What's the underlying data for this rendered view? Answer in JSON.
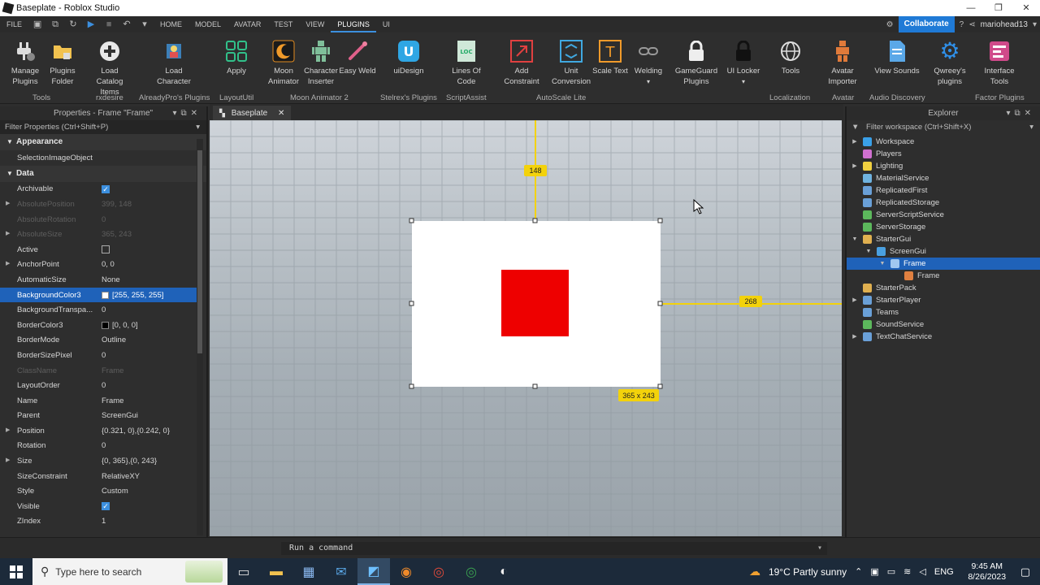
{
  "window": {
    "title": "Baseplate - Roblox Studio"
  },
  "menu": {
    "tabs": [
      "FILE",
      "HOME",
      "MODEL",
      "AVATAR",
      "TEST",
      "VIEW",
      "PLUGINS",
      "UI"
    ],
    "active_tab": "PLUGINS",
    "collaborate": "Collaborate",
    "user": "mariohead13"
  },
  "ribbon": {
    "buttons": [
      {
        "label": "Manage Plugins",
        "icon": "plug-icon"
      },
      {
        "label": "Plugins Folder",
        "icon": "folder-icon"
      },
      {
        "label": "Load Catalog Items",
        "icon": "plus-circle-icon"
      },
      {
        "label": "Load Character",
        "icon": "character-icon"
      },
      {
        "label": "Apply",
        "icon": "grid-icon"
      },
      {
        "label": "Moon Animator",
        "icon": "moon-icon"
      },
      {
        "label": "Character Inserter",
        "icon": "figure-icon"
      },
      {
        "label": "Easy Weld",
        "icon": "weld-icon"
      },
      {
        "label": "uiDesign",
        "icon": "ui-design-icon"
      },
      {
        "label": "Lines Of Code",
        "icon": "loc-icon"
      },
      {
        "label": "Add Constraint",
        "icon": "constraint-icon"
      },
      {
        "label": "Unit Conversion",
        "icon": "unit-icon"
      },
      {
        "label": "Scale Text",
        "icon": "text-scale-icon"
      },
      {
        "label": "Welding",
        "icon": "link-icon"
      },
      {
        "label": "GameGuard Plugins",
        "icon": "lock-icon"
      },
      {
        "label": "UI Locker",
        "icon": "lock-dark-icon"
      },
      {
        "label": "Tools",
        "icon": "globe-icon"
      },
      {
        "label": "Avatar Importer",
        "icon": "avatar-icon"
      },
      {
        "label": "View Sounds",
        "icon": "document-icon"
      },
      {
        "label": "Qwreey's plugins",
        "icon": "gear-icon"
      },
      {
        "label": "Interface Tools",
        "icon": "interface-icon"
      }
    ],
    "groups": [
      "Tools",
      "rxdesire",
      "AlreadyPro's Plugins",
      "LayoutUtil",
      "Moon Animator 2",
      "Stelrex's Plugins",
      "ScriptAssist",
      "AutoScale Lite",
      "Localization",
      "Avatar",
      "Audio Discovery",
      "Factor Plugins"
    ]
  },
  "properties": {
    "title": "Properties - Frame \"Frame\"",
    "filter_placeholder": "Filter Properties (Ctrl+Shift+P)",
    "sections": {
      "appearance": "Appearance",
      "data": "Data"
    },
    "appearance_rows": [
      {
        "name": "SelectionImageObject",
        "value": ""
      }
    ],
    "data_rows": [
      {
        "name": "Archivable",
        "value": "",
        "checkbox": true
      },
      {
        "name": "AbsolutePosition",
        "value": "399, 148",
        "dim": true,
        "expand": true
      },
      {
        "name": "AbsoluteRotation",
        "value": "0",
        "dim": true
      },
      {
        "name": "AbsoluteSize",
        "value": "365, 243",
        "dim": true,
        "expand": true
      },
      {
        "name": "Active",
        "value": "",
        "checkbox": false
      },
      {
        "name": "AnchorPoint",
        "value": "0, 0",
        "expand": true
      },
      {
        "name": "AutomaticSize",
        "value": "None"
      },
      {
        "name": "BackgroundColor3",
        "value": "[255, 255, 255]",
        "swatch": "#ffffff",
        "selected": true
      },
      {
        "name": "BackgroundTranspa...",
        "value": "0"
      },
      {
        "name": "BorderColor3",
        "value": "[0, 0, 0]",
        "swatch": "#000000"
      },
      {
        "name": "BorderMode",
        "value": "Outline"
      },
      {
        "name": "BorderSizePixel",
        "value": "0"
      },
      {
        "name": "ClassName",
        "value": "Frame",
        "dim": true
      },
      {
        "name": "LayoutOrder",
        "value": "0"
      },
      {
        "name": "Name",
        "value": "Frame"
      },
      {
        "name": "Parent",
        "value": "ScreenGui"
      },
      {
        "name": "Position",
        "value": "{0.321, 0},{0.242, 0}",
        "expand": true
      },
      {
        "name": "Rotation",
        "value": "0"
      },
      {
        "name": "Size",
        "value": "{0, 365},{0, 243}",
        "expand": true
      },
      {
        "name": "SizeConstraint",
        "value": "RelativeXY"
      },
      {
        "name": "Style",
        "value": "Custom"
      },
      {
        "name": "Visible",
        "value": "",
        "checkbox": true
      },
      {
        "name": "ZIndex",
        "value": "1"
      }
    ]
  },
  "viewport": {
    "tab": "Baseplate",
    "top_offset_label": "148",
    "right_offset_label": "268",
    "size_label": "365 x 243",
    "colors": {
      "frame": "#ffffff",
      "inner": "#ee0000",
      "guide": "#f3d20b"
    }
  },
  "explorer": {
    "title": "Explorer",
    "filter_placeholder": "Filter workspace (Ctrl+Shift+X)",
    "items": [
      {
        "label": "Workspace",
        "depth": 0,
        "expand": "closed",
        "color": "#3aa0e8"
      },
      {
        "label": "Players",
        "depth": 0,
        "expand": "none",
        "color": "#d070d0"
      },
      {
        "label": "Lighting",
        "depth": 0,
        "expand": "closed",
        "color": "#f0d040"
      },
      {
        "label": "MaterialService",
        "depth": 0,
        "expand": "none",
        "color": "#6fb3e0"
      },
      {
        "label": "ReplicatedFirst",
        "depth": 0,
        "expand": "none",
        "color": "#6aa0d8"
      },
      {
        "label": "ReplicatedStorage",
        "depth": 0,
        "expand": "none",
        "color": "#6aa0d8"
      },
      {
        "label": "ServerScriptService",
        "depth": 0,
        "expand": "none",
        "color": "#5cb85c"
      },
      {
        "label": "ServerStorage",
        "depth": 0,
        "expand": "none",
        "color": "#5cb85c"
      },
      {
        "label": "StarterGui",
        "depth": 0,
        "expand": "open",
        "color": "#e0b050"
      },
      {
        "label": "ScreenGui",
        "depth": 1,
        "expand": "open",
        "color": "#4aa0e0"
      },
      {
        "label": "Frame",
        "depth": 2,
        "expand": "open",
        "color": "#a0c8f0",
        "selected": true
      },
      {
        "label": "Frame",
        "depth": 3,
        "expand": "none",
        "color": "#e08040"
      },
      {
        "label": "StarterPack",
        "depth": 0,
        "expand": "none",
        "color": "#e0b050"
      },
      {
        "label": "StarterPlayer",
        "depth": 0,
        "expand": "closed",
        "color": "#6aa0d8"
      },
      {
        "label": "Teams",
        "depth": 0,
        "expand": "none",
        "color": "#6aa0d8"
      },
      {
        "label": "SoundService",
        "depth": 0,
        "expand": "none",
        "color": "#5cb85c"
      },
      {
        "label": "TextChatService",
        "depth": 0,
        "expand": "closed",
        "color": "#6aa0d8"
      }
    ]
  },
  "command_bar": {
    "placeholder": "Run a command"
  },
  "taskbar": {
    "search_placeholder": "Type here to search",
    "weather": "19°C  Partly sunny",
    "lang": "ENG",
    "time": "9:45 AM",
    "date": "8/26/2023"
  }
}
